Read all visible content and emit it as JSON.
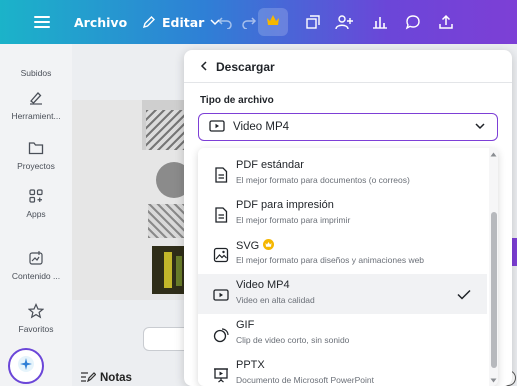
{
  "toolbar": {
    "file_label": "Archivo",
    "edit_label": "Editar"
  },
  "sidebar": {
    "items": [
      {
        "label": "Subidos",
        "icon": "upload-icon"
      },
      {
        "label": "Herramient...",
        "icon": "draw-tool-icon"
      },
      {
        "label": "Proyectos",
        "icon": "folder-icon"
      },
      {
        "label": "Apps",
        "icon": "apps-icon"
      },
      {
        "label": "Contenido ...",
        "icon": "content-icon"
      },
      {
        "label": "Favoritos",
        "icon": "star-icon"
      }
    ]
  },
  "bottom": {
    "notes_label": "Notas"
  },
  "panel": {
    "back_label": "Descargar",
    "file_type_label": "Tipo de archivo",
    "selected_value": "Video MP4",
    "options": [
      {
        "title": "PDF estándar",
        "desc": "El mejor formato para documentos (o correos)",
        "icon": "pdf-doc-icon",
        "selected": false
      },
      {
        "title": "PDF para impresión",
        "desc": "El mejor formato para imprimir",
        "icon": "pdf-print-icon",
        "selected": false
      },
      {
        "title": "SVG",
        "desc": "El mejor formato para diseños y animaciones web",
        "icon": "svg-image-icon",
        "selected": false,
        "badge": "crown-icon"
      },
      {
        "title": "Video MP4",
        "desc": "Video en alta calidad",
        "icon": "video-icon",
        "selected": true
      },
      {
        "title": "GIF",
        "desc": "Clip de video corto, sin sonido",
        "icon": "gif-icon",
        "selected": false
      },
      {
        "title": "PPTX",
        "desc": "Documento de Microsoft PowerPoint",
        "icon": "presentation-icon",
        "selected": false
      }
    ]
  },
  "colors": {
    "accent": "#7d3fd6",
    "toolbar_start": "#1bb3c9",
    "toolbar_end": "#7d3fd6",
    "crown": "#f5b700"
  }
}
